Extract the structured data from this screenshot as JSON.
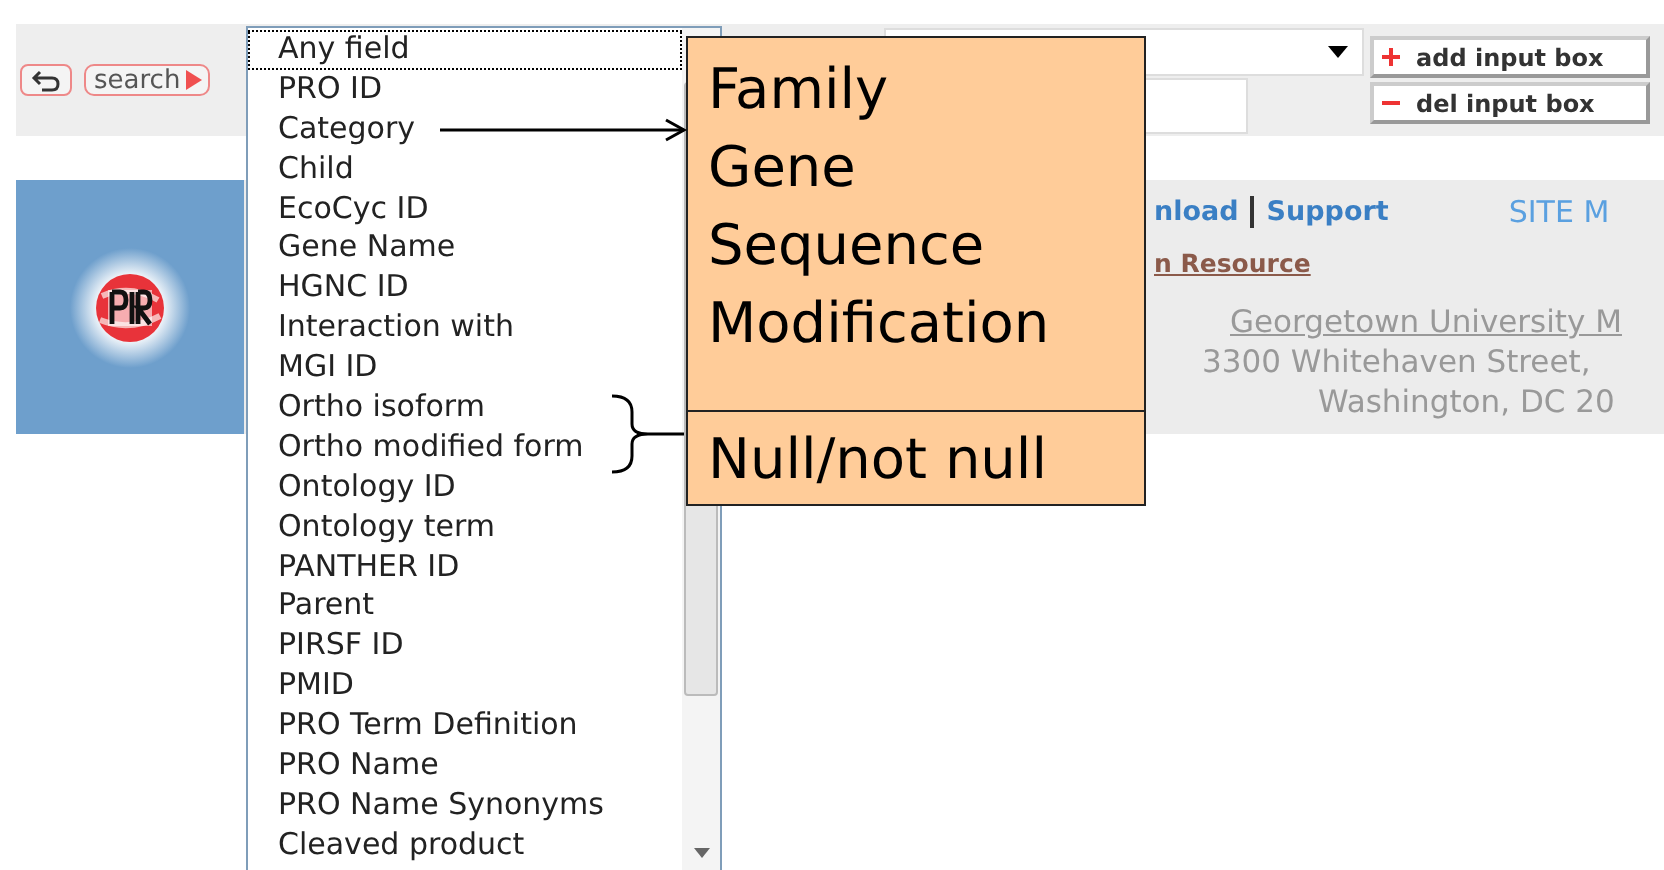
{
  "toolbar": {
    "search_button": "search",
    "add_button": "add input box",
    "del_button": "del input box"
  },
  "field_menu": {
    "items": [
      {
        "label": "Any field",
        "selected": true
      },
      {
        "label": "PRO ID",
        "selected": false
      },
      {
        "label": "Category",
        "selected": false
      },
      {
        "label": "Child",
        "selected": false
      },
      {
        "label": "EcoCyc ID",
        "selected": false
      },
      {
        "label": "Gene Name",
        "selected": false
      },
      {
        "label": "HGNC ID",
        "selected": false
      },
      {
        "label": "Interaction with",
        "selected": false
      },
      {
        "label": "MGI ID",
        "selected": false
      },
      {
        "label": "Ortho isoform",
        "selected": false
      },
      {
        "label": "Ortho modified form",
        "selected": false
      },
      {
        "label": "Ontology ID",
        "selected": false
      },
      {
        "label": "Ontology term",
        "selected": false
      },
      {
        "label": "PANTHER ID",
        "selected": false
      },
      {
        "label": "Parent",
        "selected": false
      },
      {
        "label": "PIRSF ID",
        "selected": false
      },
      {
        "label": "PMID",
        "selected": false
      },
      {
        "label": "PRO Term Definition",
        "selected": false
      },
      {
        "label": "PRO Name",
        "selected": false
      },
      {
        "label": "PRO Name Synonyms",
        "selected": false
      },
      {
        "label": "Cleaved product",
        "selected": false
      }
    ]
  },
  "banner": {
    "links": [
      "nload",
      "Support"
    ],
    "site_map": "SITE M",
    "resource_link": "n Resource",
    "address": [
      "Georgetown University M",
      "3300 Whitehaven Street,",
      "Washington, DC 20"
    ]
  },
  "callout": {
    "sections": [
      {
        "lines": [
          "Family",
          "Gene",
          "Sequence",
          "Modification"
        ]
      },
      {
        "lines": [
          "Null/not null"
        ]
      }
    ]
  }
}
